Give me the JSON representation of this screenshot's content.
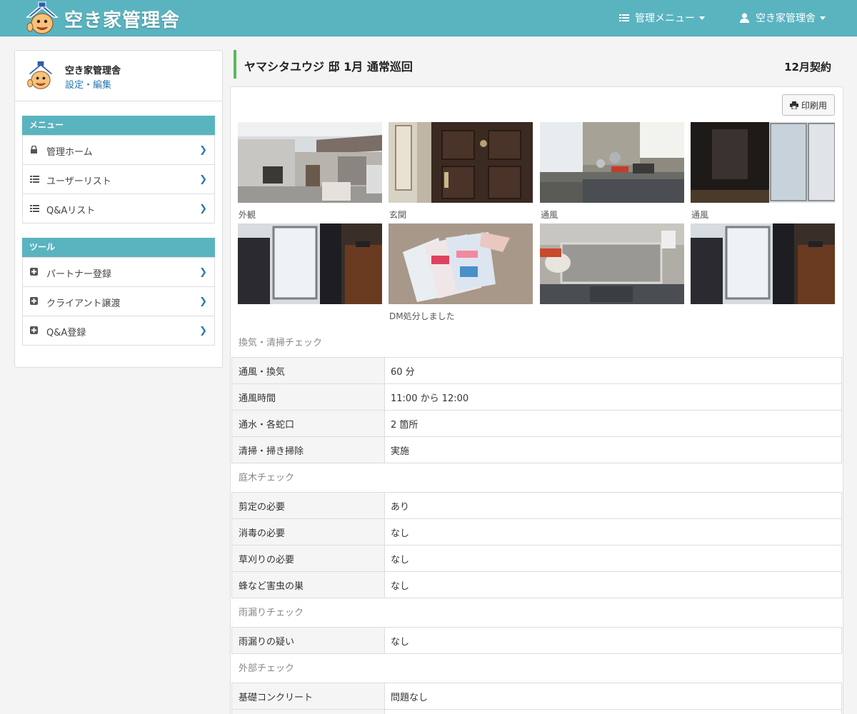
{
  "header": {
    "brand": "空き家管理舎",
    "admin_menu": "管理メニュー",
    "user_menu": "空き家管理舎"
  },
  "sidebar": {
    "profile_name": "空き家管理舎",
    "profile_edit": "設定・編集",
    "menu_title": "メニュー",
    "menu_items": [
      {
        "label": "管理ホーム",
        "icon": "lock-icon"
      },
      {
        "label": "ユーザーリスト",
        "icon": "list-icon"
      },
      {
        "label": "Q&Aリスト",
        "icon": "list-icon"
      }
    ],
    "tools_title": "ツール",
    "tool_items": [
      {
        "label": "パートナー登録",
        "icon": "plus-square-icon"
      },
      {
        "label": "クライアント譲渡",
        "icon": "plus-square-icon"
      },
      {
        "label": "Q&A登録",
        "icon": "plus-square-icon"
      }
    ]
  },
  "page": {
    "title": "ヤマシタユウジ 邸 1月 通常巡回",
    "contract": "12月契約",
    "print_button": "印刷用"
  },
  "photos": [
    {
      "caption": "外観",
      "scene": "house-exterior"
    },
    {
      "caption": "玄関",
      "scene": "front-door"
    },
    {
      "caption": "通風",
      "scene": "kitchen-window"
    },
    {
      "caption": "通風",
      "scene": "dark-room-window"
    },
    {
      "caption": "",
      "scene": "room-window"
    },
    {
      "caption": "DM処分しました",
      "scene": "flyers-on-floor"
    },
    {
      "caption": "",
      "scene": "kitchen-sink"
    },
    {
      "caption": "",
      "scene": "room-window"
    }
  ],
  "sections": [
    {
      "title": "換気・清掃チェック",
      "rows": [
        {
          "key": "通風・換気",
          "value": "60 分"
        },
        {
          "key": "通風時間",
          "value": "11:00 から 12:00"
        },
        {
          "key": "通水・各蛇口",
          "value": "2 箇所"
        },
        {
          "key": "清掃・掃き掃除",
          "value": "実施"
        }
      ]
    },
    {
      "title": "庭木チェック",
      "rows": [
        {
          "key": "剪定の必要",
          "value": "あり"
        },
        {
          "key": "消毒の必要",
          "value": "なし"
        },
        {
          "key": "草刈りの必要",
          "value": "なし"
        },
        {
          "key": "蜂など害虫の巣",
          "value": "なし"
        }
      ]
    },
    {
      "title": "雨漏りチェック",
      "rows": [
        {
          "key": "雨漏りの疑い",
          "value": "なし"
        }
      ]
    },
    {
      "title": "外部チェック",
      "rows": [
        {
          "key": "基礎コンクリート",
          "value": "問題なし"
        },
        {
          "key": "",
          "value": ""
        }
      ]
    }
  ],
  "colors": {
    "accent": "#5ab4c0",
    "link": "#2a7ab0",
    "title_border": "#5cb85c"
  }
}
